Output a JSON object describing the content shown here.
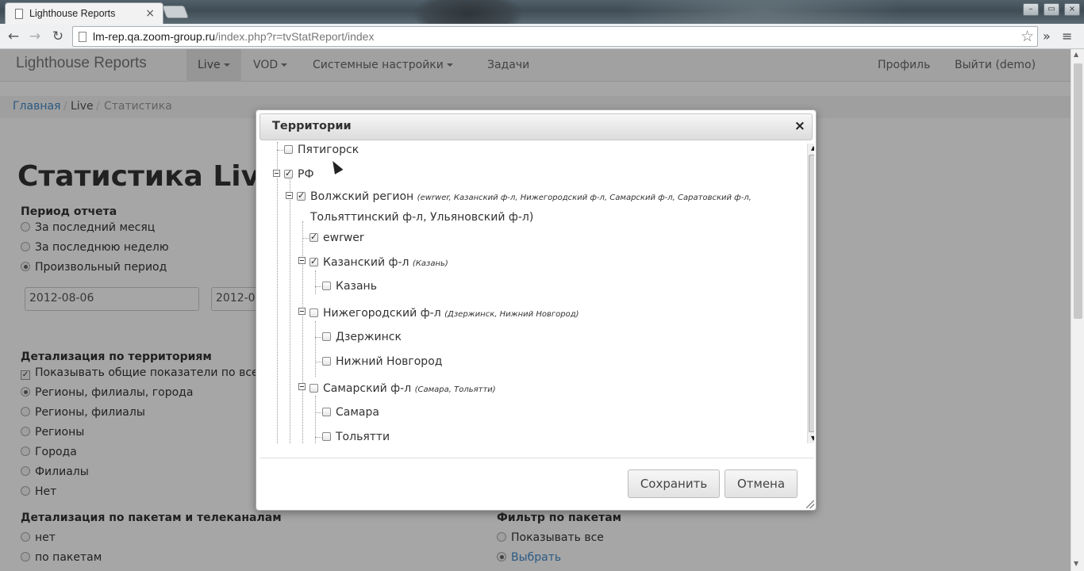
{
  "browser": {
    "tab_title": "Lighthouse Reports",
    "tab_close": "×",
    "url_host": "lm-rep.qa.zoom-group.ru",
    "url_path": "/index.php?r=tvStatReport/index",
    "win_min": "–",
    "win_max": "▭",
    "win_close": "×"
  },
  "navbar": {
    "brand": "Lighthouse Reports",
    "items": [
      {
        "label": "Live",
        "dropdown": true,
        "active": true
      },
      {
        "label": "VOD",
        "dropdown": true
      },
      {
        "label": "Системные настройки",
        "dropdown": true
      },
      {
        "label": "Задачи",
        "dropdown": false
      }
    ],
    "right": [
      {
        "label": "Профиль"
      },
      {
        "label": "Выйти (demo)"
      }
    ]
  },
  "breadcrumb": {
    "home": "Главная",
    "sep": "/",
    "live": "Live",
    "current": "Статистика"
  },
  "page": {
    "title": "Статистика Live",
    "period_label": "Период отчета",
    "period_options": [
      "За последний месяц",
      "За последнюю неделю",
      "Произвольный период"
    ],
    "period_selected": 2,
    "date_from": "2012-08-06",
    "date_to": "2012-0",
    "territory_label": "Детализация по территориям",
    "show_totals": "Показывать общие показатели по все",
    "territory_options": [
      "Регионы, филиалы, города",
      "Регионы, филиалы",
      "Регионы",
      "Города",
      "Филиалы",
      "Нет"
    ],
    "territory_selected": 0,
    "packages_label": "Детализация по пакетам и телеканалам",
    "packages_options": [
      "нет",
      "по пакетам"
    ],
    "filter_label": "Фильтр по пакетам",
    "filter_options": [
      "Показывать все",
      "Выбрать"
    ],
    "filter_selected": 1
  },
  "modal": {
    "title": "Территории",
    "close": "×",
    "tree": [
      {
        "label": "Пятигорск",
        "checked": false
      },
      {
        "label": "РФ",
        "checked": true
      },
      {
        "label": "Волжский регион",
        "note": "(ewrwer, Казанский ф-л, Нижегородский ф-л, Самарский ф-л, Саратовский ф-л,",
        "note2": "Тольяттинский ф-л, Ульяновский ф-л)",
        "checked": true
      },
      {
        "label": "ewrwer",
        "checked": true
      },
      {
        "label": "Казанский ф-л",
        "note": "(Казань)",
        "checked": true
      },
      {
        "label": "Казань",
        "checked": false
      },
      {
        "label": "Нижегородский ф-л",
        "note": "(Дзержинск, Нижний Новгород)",
        "checked": false
      },
      {
        "label": "Дзержинск",
        "checked": false
      },
      {
        "label": "Нижний Новгород",
        "checked": false
      },
      {
        "label": "Самарский ф-л",
        "note": "(Самара, Тольятти)",
        "checked": false
      },
      {
        "label": "Самара",
        "checked": false
      },
      {
        "label": "Тольятти",
        "checked": false
      }
    ],
    "save": "Сохранить",
    "cancel": "Отмена"
  }
}
